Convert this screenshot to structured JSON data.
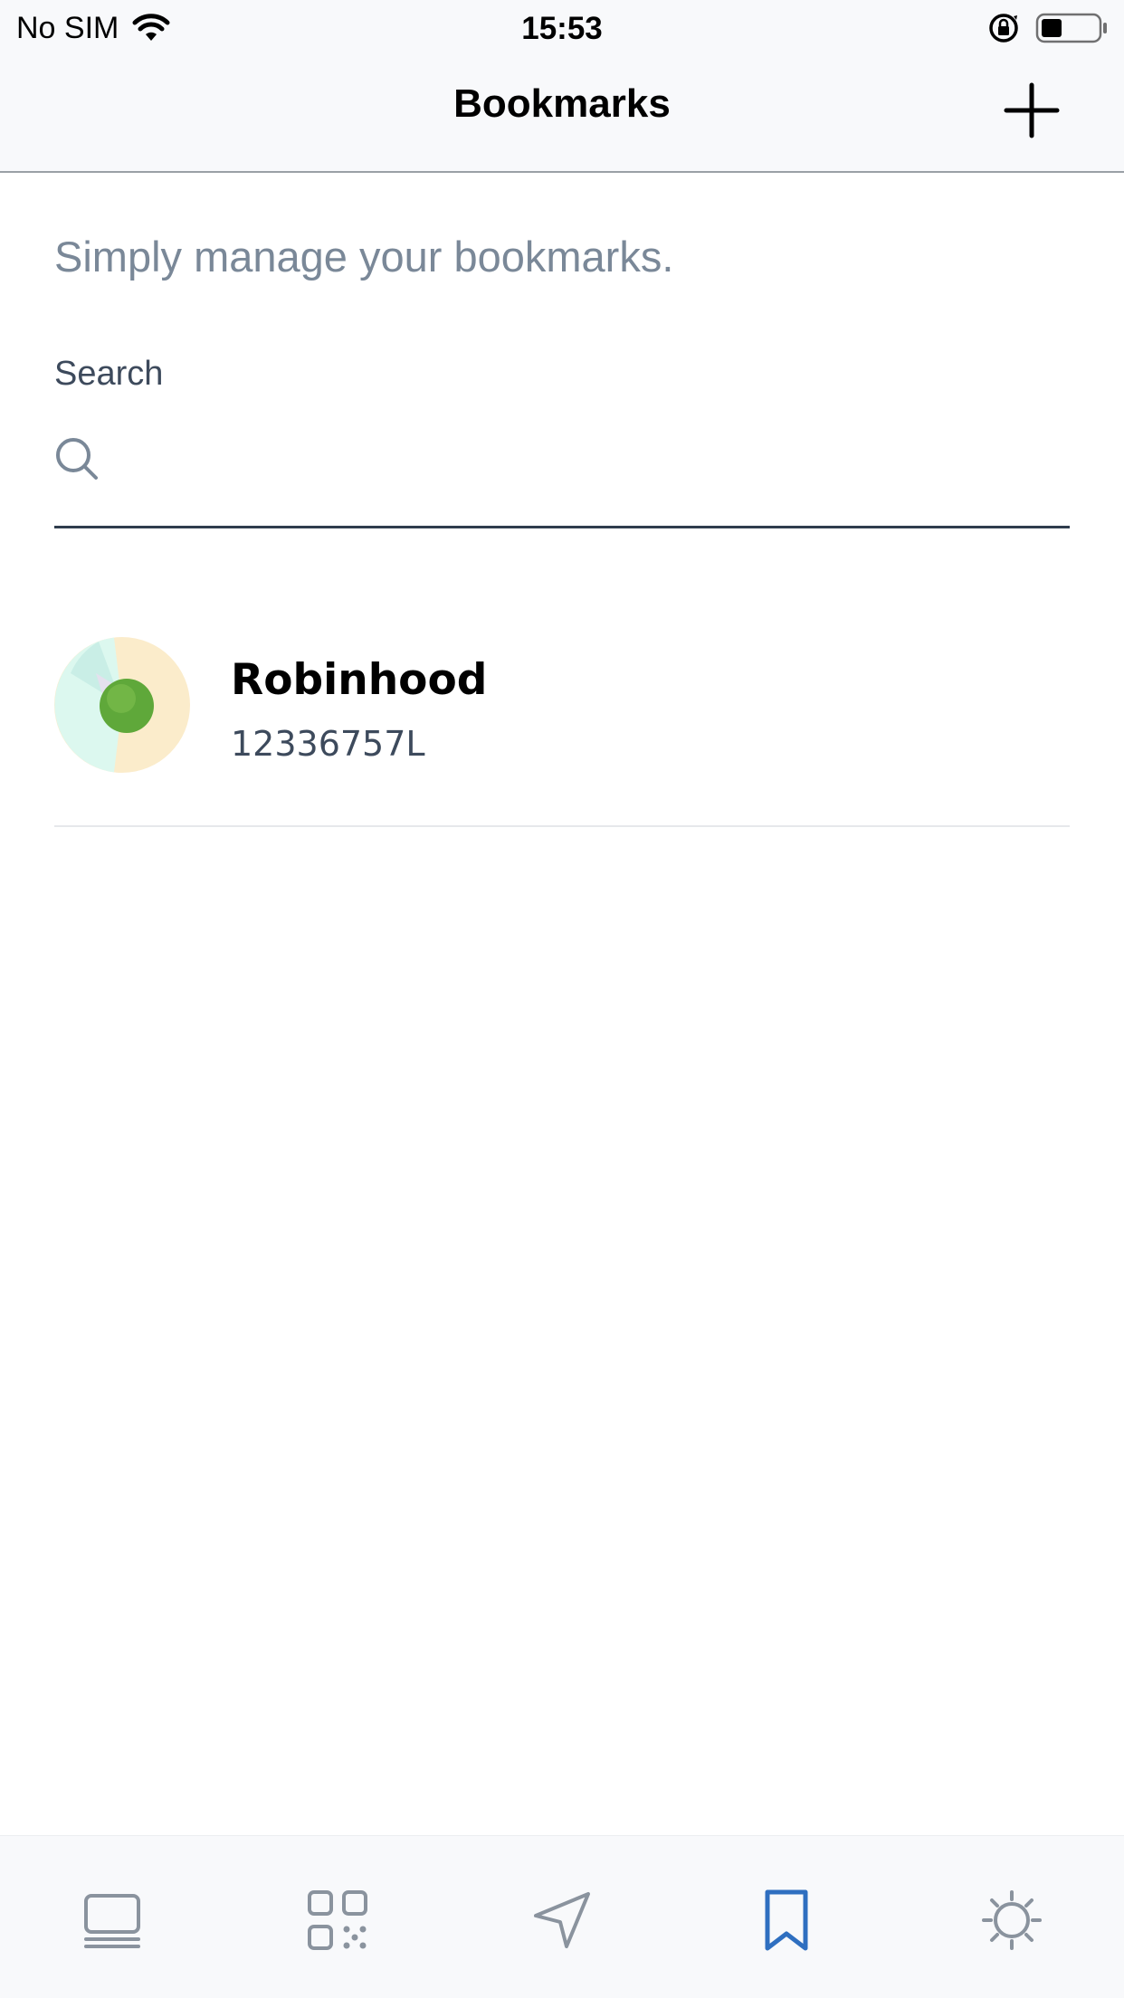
{
  "status_bar": {
    "carrier": "No SIM",
    "time": "15:53"
  },
  "navbar": {
    "title": "Bookmarks",
    "add_icon": "plus-icon"
  },
  "content": {
    "subtitle": "Simply manage your bookmarks.",
    "search": {
      "label": "Search",
      "value": "",
      "placeholder": ""
    },
    "bookmarks": [
      {
        "name": "Robinhood",
        "id": "12336757L"
      }
    ]
  },
  "tabbar": {
    "tabs": [
      {
        "icon": "wallet-icon",
        "active": false
      },
      {
        "icon": "qr-code-icon",
        "active": false
      },
      {
        "icon": "send-icon",
        "active": false
      },
      {
        "icon": "bookmark-icon",
        "active": true
      },
      {
        "icon": "settings-icon",
        "active": false
      }
    ],
    "active_color": "#2f6fc0",
    "inactive_color": "#8a939e"
  }
}
